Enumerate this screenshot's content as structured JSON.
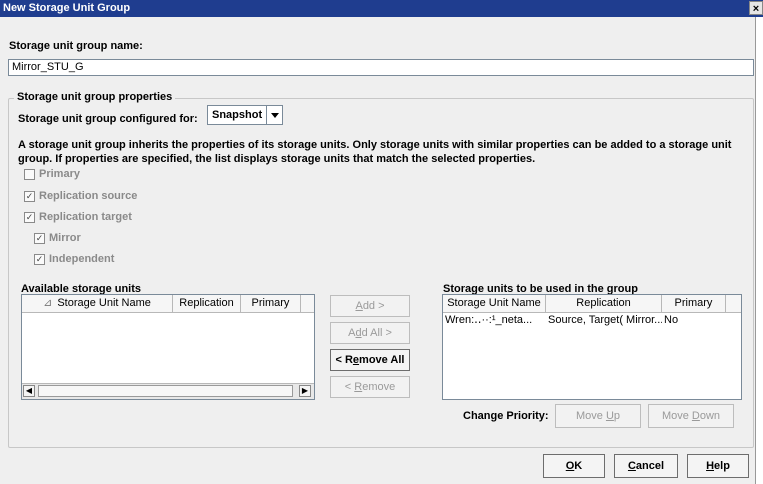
{
  "window": {
    "title": "New Storage Unit Group",
    "close_glyph": "×"
  },
  "name_section": {
    "label": "Storage unit group name:",
    "value": "Mirror_STU_G"
  },
  "properties": {
    "legend": "Storage unit group properties",
    "configured_for_label": "Storage unit group configured for:",
    "configured_for_value": "Snapshot",
    "description_line1": "A storage unit group inherits the properties of its storage units. Only storage units with similar properties can be added to a storage unit",
    "description_line2": "group. If properties are specified, the list displays storage units that match the selected properties.",
    "checkboxes": [
      {
        "label": "Primary",
        "checked": false
      },
      {
        "label": "Replication source",
        "checked": true
      },
      {
        "label": "Replication target",
        "checked": true
      },
      {
        "label": "Mirror",
        "checked": true
      },
      {
        "label": "Independent",
        "checked": true
      }
    ]
  },
  "available": {
    "title": "Available storage units",
    "columns": [
      "Storage Unit Name",
      "Replication",
      "Primary"
    ],
    "sort_glyph": "⊿"
  },
  "transfer_buttons": {
    "add": {
      "pre": "",
      "u": "A",
      "post": "dd >"
    },
    "add_all": {
      "pre": "A",
      "u": "d",
      "post": "d All >"
    },
    "remove_all": {
      "pre": "< R",
      "u": "e",
      "post": "move All"
    },
    "remove": {
      "pre": "< ",
      "u": "R",
      "post": "emove"
    }
  },
  "selected": {
    "title": "Storage units to be used in the group",
    "columns": [
      "Storage Unit Name",
      "Replication",
      "Primary"
    ],
    "rows": [
      {
        "name": "Wren:‥··:¹_neta...",
        "replication": "Source, Target( Mirror...",
        "primary": "No"
      }
    ]
  },
  "priority": {
    "label": "Change Priority:",
    "move_up": {
      "pre": "Move ",
      "u": "U",
      "post": "p"
    },
    "move_down": {
      "pre": "Move ",
      "u": "D",
      "post": "own"
    }
  },
  "footer": {
    "ok": {
      "pre": "",
      "u": "O",
      "post": "K"
    },
    "cancel": {
      "pre": "",
      "u": "C",
      "post": "ancel"
    },
    "help": {
      "pre": "",
      "u": "H",
      "post": "elp"
    }
  }
}
